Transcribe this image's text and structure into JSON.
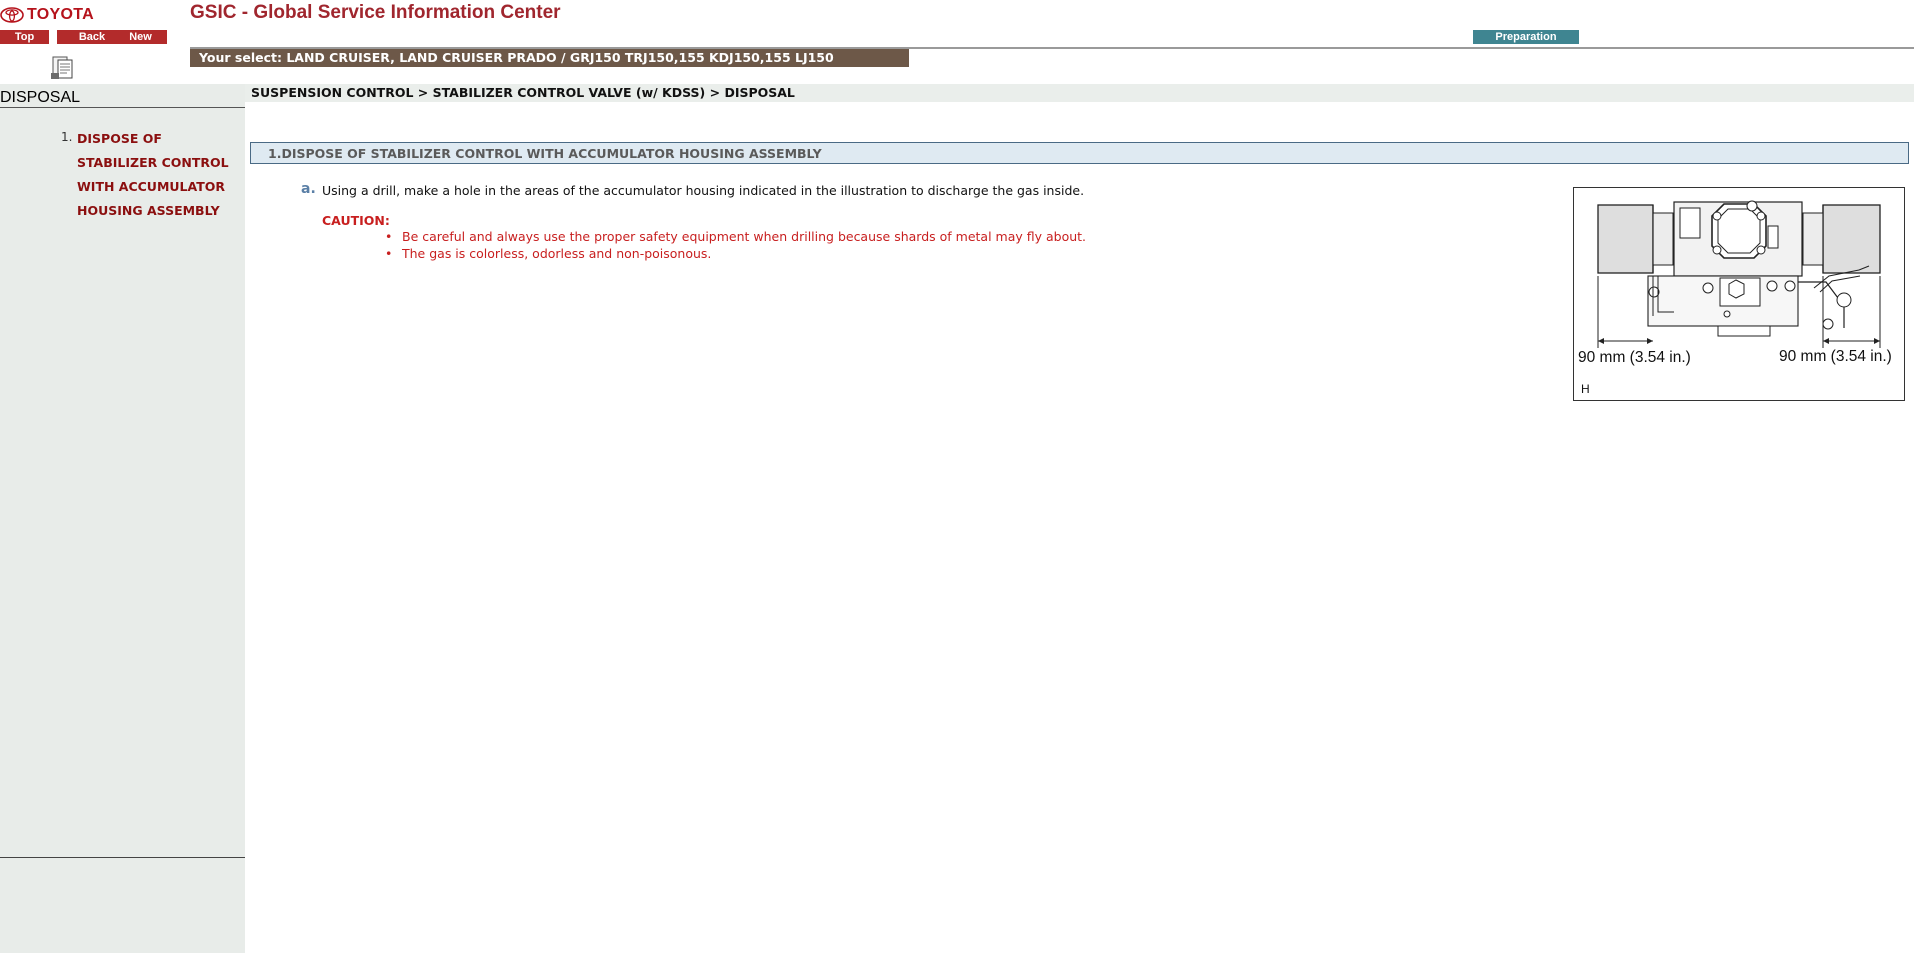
{
  "header": {
    "logo_text": "TOYOTA",
    "app_title": "GSIC - Global Service Information Center",
    "nav": {
      "top": "Top",
      "back": "Back",
      "new": "New"
    },
    "preparation_button": "Preparation",
    "selection": "Your select: LAND CRUISER, LAND CRUISER PRADO / GRJ150 TRJ150,155 KDJ150,155 LJ150"
  },
  "sidebar": {
    "title": "DISPOSAL",
    "items": [
      {
        "number": "1.",
        "label": "DISPOSE OF STABILIZER CONTROL WITH ACCUMULATOR HOUSING ASSEMBLY"
      }
    ]
  },
  "breadcrumb": "SUSPENSION CONTROL > STABILIZER CONTROL VALVE (w/ KDSS) > DISPOSAL",
  "section": {
    "title": "1.DISPOSE OF STABILIZER CONTROL WITH ACCUMULATOR HOUSING ASSEMBLY",
    "step": {
      "label": "a.",
      "text": "Using a drill, make a hole in the areas of the accumulator housing indicated in the illustration to discharge the gas inside."
    },
    "caution": {
      "label": "CAUTION:",
      "items": [
        "Be careful and always use the proper safety equipment when drilling because shards of metal may fly about.",
        "The gas is colorless, odorless and non-poisonous."
      ]
    }
  },
  "illustration": {
    "dimension_left": "90 mm (3.54 in.)",
    "dimension_right": "90 mm (3.54 in.)",
    "code": "H"
  },
  "colors": {
    "brand_red": "#b32b2b",
    "title_red": "#a0262e",
    "preparation_teal": "#3f8591",
    "selection_brown": "#6d5848",
    "caution_red": "#c81f1f",
    "sidebar_bg": "#e8ece9"
  },
  "icons": {
    "logo": "toyota-emblem-icon",
    "document": "document-icon"
  }
}
